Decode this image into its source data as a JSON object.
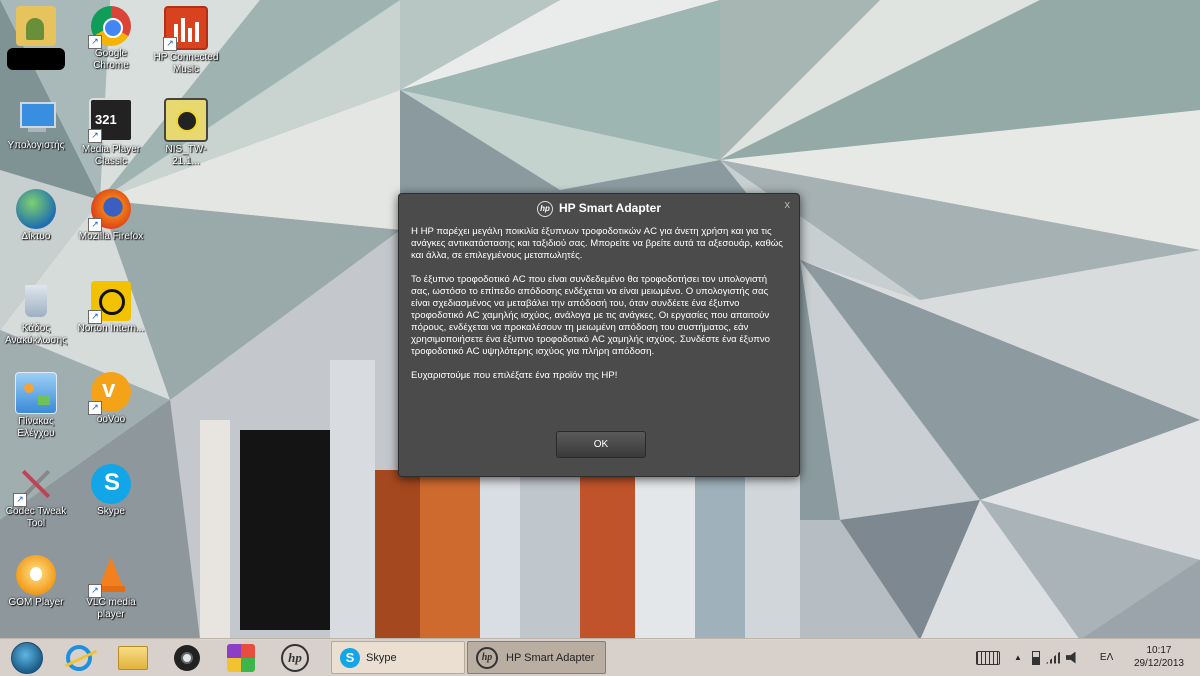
{
  "desktop": {
    "icons": [
      {
        "label": "",
        "icon": "user-folder-icon"
      },
      {
        "label": "Google Chrome",
        "icon": "chrome-icon"
      },
      {
        "label": "HP Connected Music",
        "icon": "hp-music-icon"
      },
      {
        "label": "Υπολογιστής",
        "icon": "computer-icon"
      },
      {
        "label": "Media Player Classic",
        "icon": "mpc-icon"
      },
      {
        "label": "NIS_TW-21.1...",
        "icon": "installer-box-icon"
      },
      {
        "label": "Δίκτυο",
        "icon": "network-globe-icon"
      },
      {
        "label": "Mozilla Firefox",
        "icon": "firefox-icon"
      },
      {
        "label": "Κάδος Ανακύκλωσης",
        "icon": "recycle-bin-icon"
      },
      {
        "label": "Norton Intern...",
        "icon": "norton-icon"
      },
      {
        "label": "Πίνακας Ελέγχου",
        "icon": "control-panel-icon"
      },
      {
        "label": "ooVoo",
        "icon": "oovoo-icon"
      },
      {
        "label": "Codec Tweak Tool",
        "icon": "codec-tools-icon"
      },
      {
        "label": "Skype",
        "icon": "skype-icon"
      },
      {
        "label": "GOM Player",
        "icon": "gom-player-icon"
      },
      {
        "label": "VLC media player",
        "icon": "vlc-icon"
      }
    ]
  },
  "dialog": {
    "title": "HP Smart Adapter",
    "logo_text": "hp",
    "close_label": "x",
    "paragraphs": [
      "Η HP παρέχει μεγάλη ποικιλία έξυπνων τροφοδοτικών AC για άνετη χρήση και για τις ανάγκες αντικατάστασης και ταξιδιού σας. Μπορείτε να βρείτε αυτά τα αξεσουάρ, καθώς και άλλα, σε επιλεγμένους μεταπωλητές.",
      "Το έξυπνο τροφοδοτικό AC που είναι συνδεδεμένο θα τροφοδοτήσει τον υπολογιστή σας, ωστόσο το επίπεδο απόδοσης ενδέχεται να είναι μειωμένο. Ο υπολογιστής σας είναι σχεδιασμένος να μεταβάλει την απόδοσή του, όταν συνδέετε ένα έξυπνο τροφοδοτικό AC χαμηλής ισχύος, ανάλογα με τις ανάγκες. Οι εργασίες που απαιτούν πόρους, ενδέχεται να προκαλέσουν τη μειωμένη απόδοση του συστήματος, εάν χρησιμοποιήσετε ένα έξυπνο τροφοδοτικό AC χαμηλής ισχύος. Συνδέστε ένα έξυπνο τροφοδοτικό AC υψηλότερης ισχύος για πλήρη απόδοση.",
      "Ευχαριστούμε που επιλέξατε ένα προϊόν της HP!"
    ],
    "ok_label": "OK"
  },
  "taskbar": {
    "pinned": [
      {
        "icon": "start-orb-icon"
      },
      {
        "icon": "internet-explorer-icon"
      },
      {
        "icon": "file-explorer-icon"
      },
      {
        "icon": "webcam-icon"
      },
      {
        "icon": "puzzle-app-icon"
      },
      {
        "icon": "hp-logo-icon"
      }
    ],
    "tasks": [
      {
        "label": "Skype",
        "icon": "skype-icon"
      },
      {
        "label": "HP Smart Adapter",
        "icon": "hp-logo-icon"
      }
    ],
    "tray": {
      "keyboard_icon": "touch-keyboard-icon",
      "show_hidden": "▲",
      "language": "ΕΛ"
    },
    "clock": {
      "time": "10:17",
      "date": "29/12/2013"
    }
  }
}
